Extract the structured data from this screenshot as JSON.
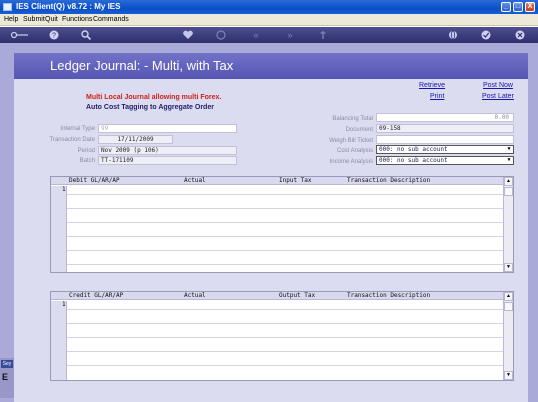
{
  "window": {
    "title": "IES Client(Q) v8.72 : My IES",
    "buttons": [
      "_",
      "□",
      "X"
    ]
  },
  "menu": [
    "Help",
    "Submit",
    "Quit",
    "Functions",
    "Commands"
  ],
  "toolbar": [
    "key-icon",
    "help-icon",
    "search-icon",
    "heart-icon",
    "history-icon",
    "back-icon",
    "forward-icon",
    "pin-icon",
    "globe-icon",
    "check-icon",
    "close-icon"
  ],
  "header": {
    "title": "Ledger Journal: - Multi, with Tax"
  },
  "links": {
    "retrieve": "Retrieve",
    "print": "Print",
    "post_now": "Post Now",
    "post_later": "Post Later"
  },
  "notes": {
    "line1": "Multi Local Journal allowing multi Forex.",
    "line2": "Auto Cost Tagging to Aggregate Order"
  },
  "left_form": {
    "internal_type": {
      "label": "Internal Type",
      "value": "99"
    },
    "transaction_date": {
      "label": "Transaction Date",
      "value": "17/11/2009"
    },
    "period": {
      "label": "Period",
      "value": "Nov 2009 (p 106)"
    },
    "batch": {
      "label": "Batch",
      "value": "TT-171109"
    }
  },
  "right_form": {
    "balancing_total": {
      "label": "Balancing Total",
      "value": "0.00"
    },
    "document": {
      "label": "Document",
      "value": "09-158"
    },
    "weigh_bill_ticket": {
      "label": "Weigh Bill Ticket",
      "value": ""
    },
    "cost_analysis": {
      "label": "Cost Analysis",
      "value": "000: no sub account"
    },
    "income_analysis": {
      "label": "Income Analysis",
      "value": "000: no sub account"
    }
  },
  "debit_grid": {
    "columns": [
      "Debit GL/AR/AP",
      "Actual",
      "Input Tax",
      "Transaction Description"
    ],
    "row_number": "1"
  },
  "credit_grid": {
    "columns": [
      "Credit GL/AR/AP",
      "Actual",
      "Output Tax",
      "Transaction Description"
    ],
    "row_number": "1"
  },
  "sidetab": {
    "label": "Sey",
    "letter": "E"
  }
}
